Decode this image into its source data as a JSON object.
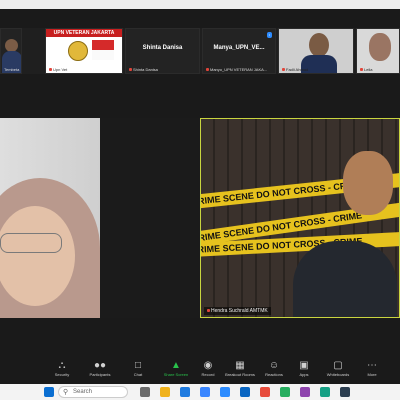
{
  "participants_strip": [
    {
      "name": "Tembeta",
      "kind": "video"
    },
    {
      "name": "Upn Vet",
      "kind": "logo",
      "banner": "UPN VETERAN JAKARTA"
    },
    {
      "name": "Shinta Danisa",
      "kind": "name",
      "display": "Shinta Danisa"
    },
    {
      "name": "Manyo_UPN VETERAN JAKA...",
      "kind": "name",
      "display": "Manya_UPN_VE..."
    },
    {
      "name": "Fadli Ahmad",
      "kind": "video"
    },
    {
      "name": "Leila",
      "kind": "video"
    }
  ],
  "main_view": {
    "left_speaker": "",
    "right_speaker_name": "Hendra Suchrald AMTMK",
    "crime_tape_text": "CRIME SCENE DO NOT CROSS - CRIME"
  },
  "toolbar": [
    {
      "label": "Security",
      "icon": "shield-icon"
    },
    {
      "label": "Participants",
      "icon": "people-icon",
      "count": "51"
    },
    {
      "label": "Chat",
      "icon": "chat-icon"
    },
    {
      "label": "Share Screen",
      "icon": "share-icon"
    },
    {
      "label": "Record",
      "icon": "record-icon"
    },
    {
      "label": "Breakout Rooms",
      "icon": "breakout-icon"
    },
    {
      "label": "Reactions",
      "icon": "reaction-icon"
    },
    {
      "label": "Apps",
      "icon": "apps-icon"
    },
    {
      "label": "Whiteboards",
      "icon": "whiteboard-icon"
    },
    {
      "label": "More",
      "icon": "more-icon"
    }
  ],
  "taskbar": {
    "search_placeholder": "Search"
  },
  "colors": {
    "share_green": "#29c24b",
    "mic_red": "#e0453a",
    "tape_yellow": "#e6c21e",
    "active_border": "#c9d53f"
  }
}
